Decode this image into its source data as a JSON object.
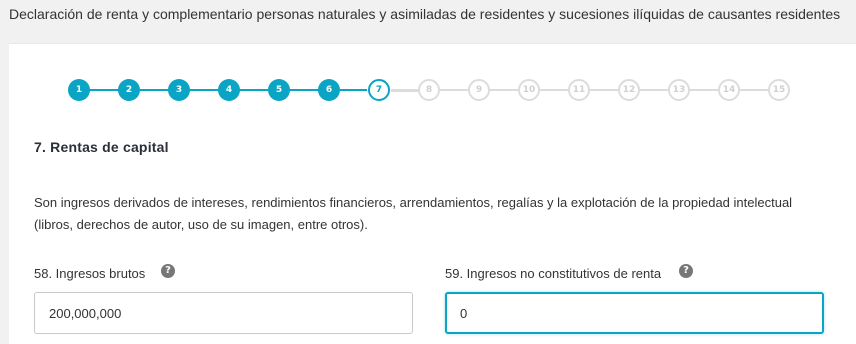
{
  "page": {
    "title": "Declaración de renta y complementario personas naturales y asimiladas de residentes y sucesiones ilíquidas de causantes residentes"
  },
  "stepper": {
    "current": 7,
    "steps": [
      "1",
      "2",
      "3",
      "4",
      "5",
      "6",
      "7",
      "8",
      "9",
      "10",
      "11",
      "12",
      "13",
      "14",
      "15"
    ]
  },
  "section": {
    "title": "7. Rentas de capital",
    "description": "Son ingresos derivados de intereses, rendimientos financieros, arrendamientos, regalías y la explotación de la propiedad intelectual (libros, derechos de autor, uso de su imagen, entre otros)."
  },
  "fields": {
    "ingresos_brutos": {
      "label": "58. Ingresos brutos",
      "value": "200,000,000",
      "help": "?"
    },
    "ingresos_no_constitutivos": {
      "label": "59. Ingresos no constitutivos de renta",
      "value": "0",
      "help": "?"
    }
  },
  "colors": {
    "accent": "#0aa4c4",
    "pending": "#dcdcdc"
  }
}
